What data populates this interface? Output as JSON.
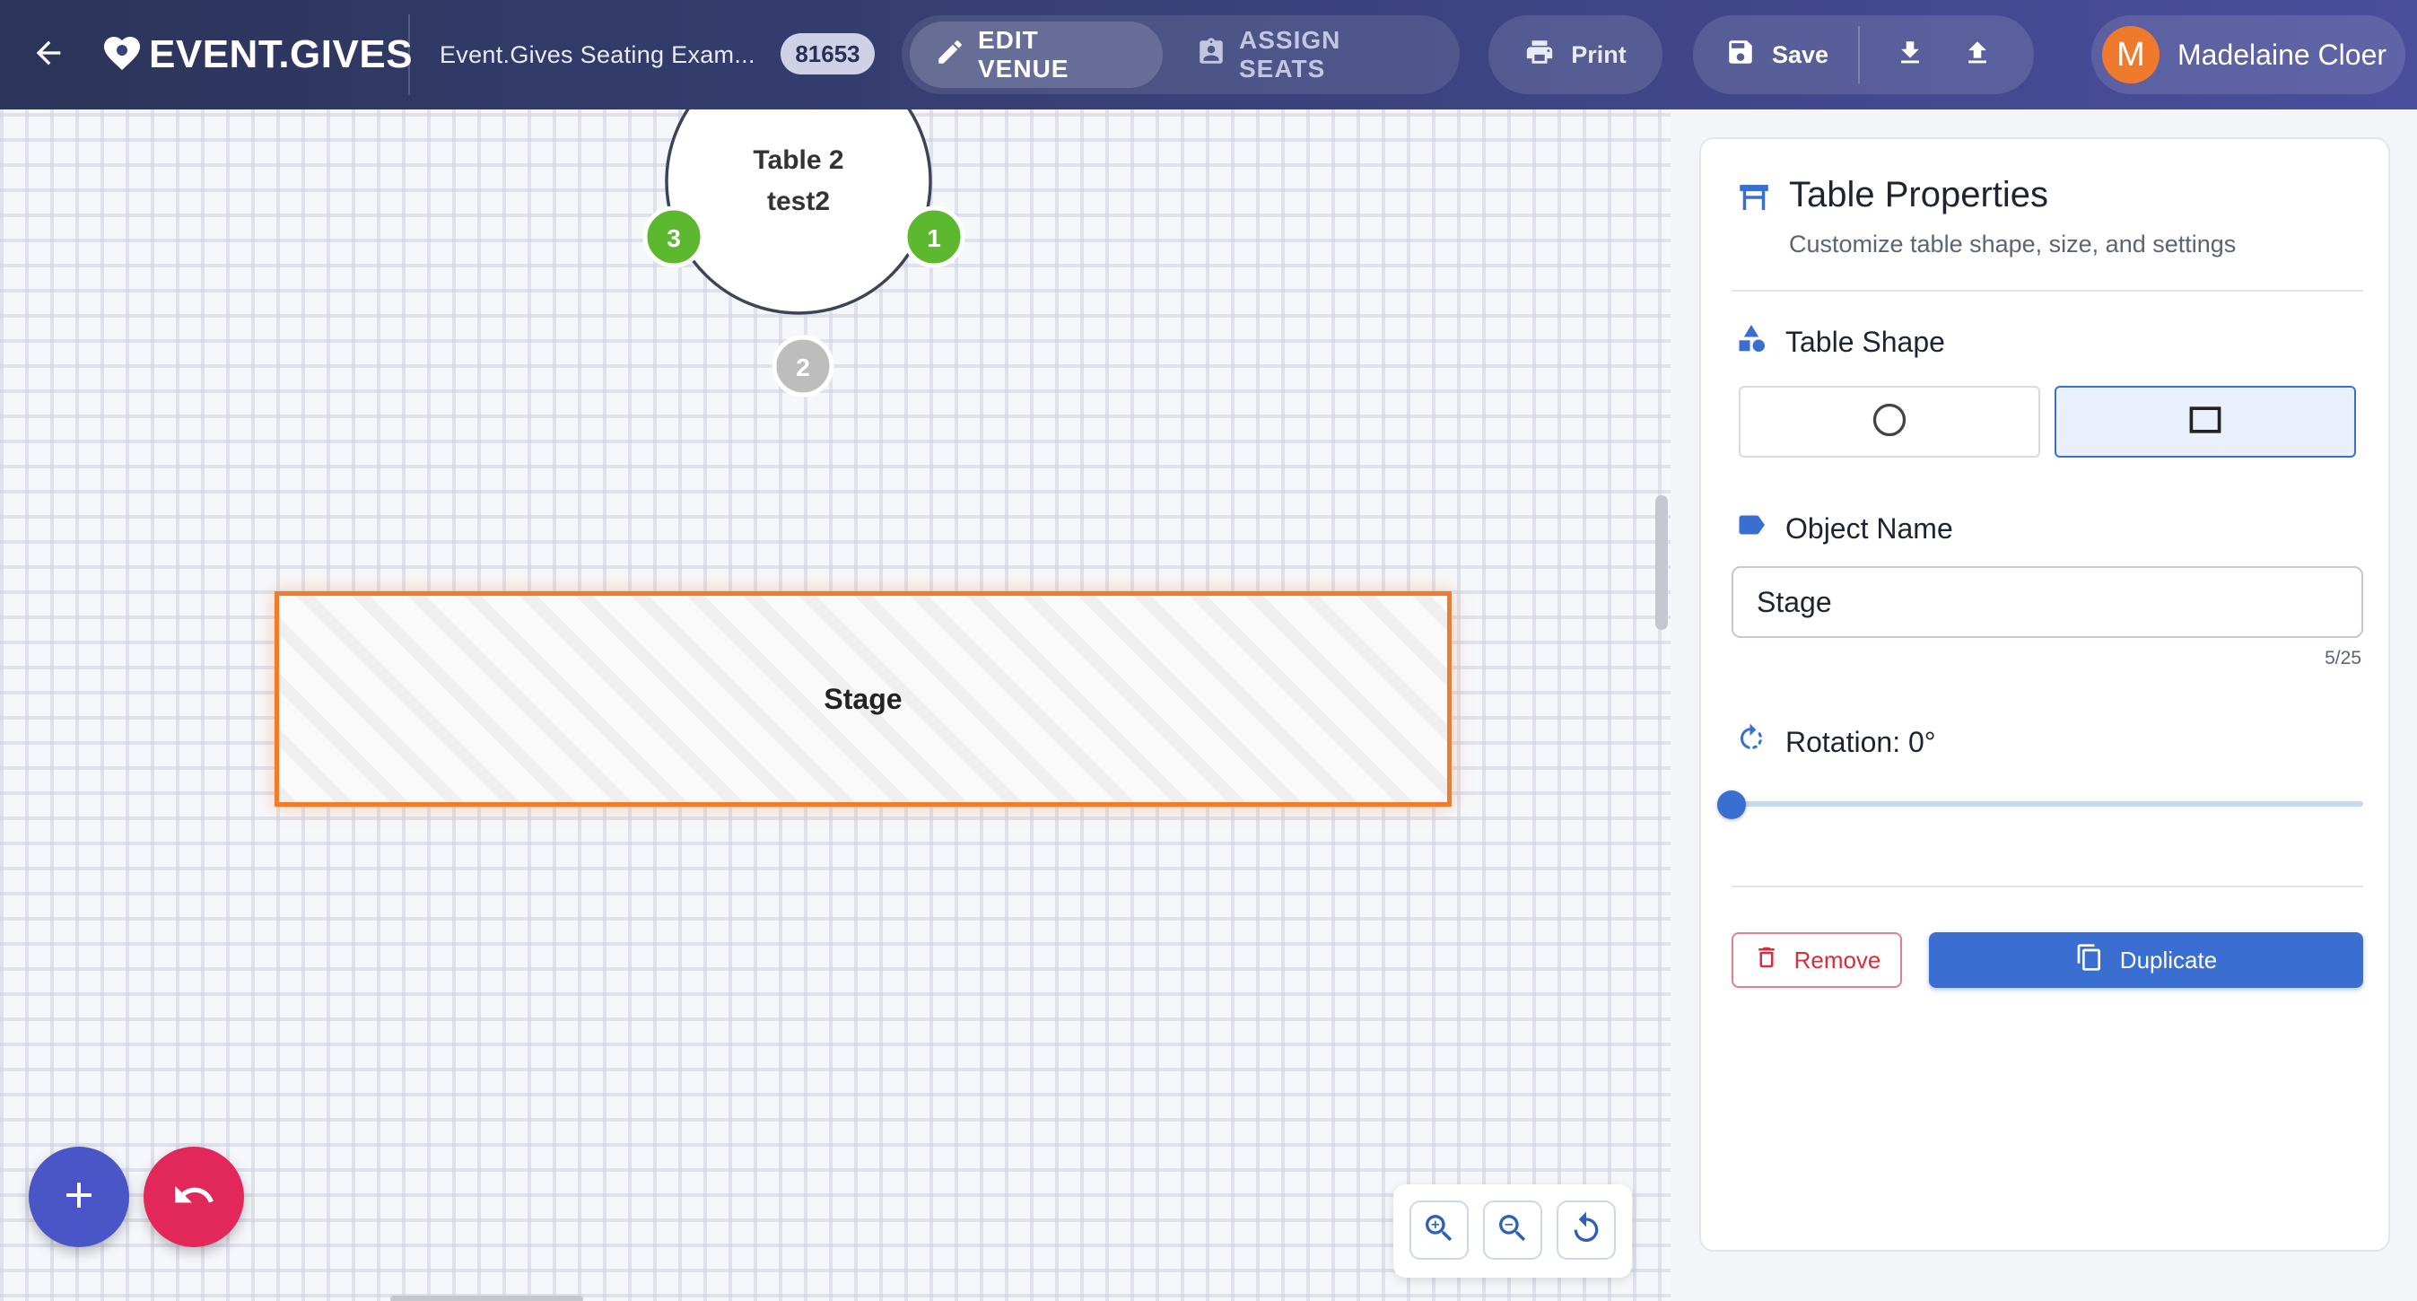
{
  "header": {
    "logo_text": "EVENT.GIVES",
    "event_title": "Event.Gives Seating Exam...",
    "event_id": "81653",
    "modes": {
      "edit_venue": "EDIT VENUE",
      "assign_seats": "ASSIGN SEATS",
      "active": "edit_venue"
    },
    "print_label": "Print",
    "save_label": "Save",
    "user": {
      "initial": "M",
      "name": "Madelaine Cloer",
      "avatar_color": "#f07a2c"
    }
  },
  "canvas": {
    "table": {
      "name_partial": "Table 2",
      "label": "test2",
      "seats": [
        {
          "number": "3",
          "status": "assigned",
          "color": "#5cb82e"
        },
        {
          "number": "1",
          "status": "assigned",
          "color": "#5cb82e"
        },
        {
          "number": "2",
          "status": "empty",
          "color": "#bdbdbd"
        }
      ]
    },
    "stage": {
      "label": "Stage",
      "highlight_color": "#f27a2a"
    },
    "fab": {
      "add_icon": "plus-icon",
      "undo_icon": "undo-icon"
    },
    "zoom_controls": {
      "zoom_in_icon": "zoom-in-icon",
      "zoom_out_icon": "zoom-out-icon",
      "reset_icon": "reset-icon"
    }
  },
  "panel": {
    "title": "Table Properties",
    "subtitle": "Customize table shape, size, and settings",
    "table_shape_label": "Table Shape",
    "shapes": {
      "options": [
        "round",
        "rectangle"
      ],
      "selected": "rectangle"
    },
    "object_name_label": "Object Name",
    "object_name_value": "Stage",
    "char_count": "5/25",
    "rotation_label": "Rotation: 0°",
    "rotation_value": 0,
    "rotation_max": 360,
    "remove_label": "Remove",
    "duplicate_label": "Duplicate",
    "accent_color": "#3a6fd1"
  }
}
